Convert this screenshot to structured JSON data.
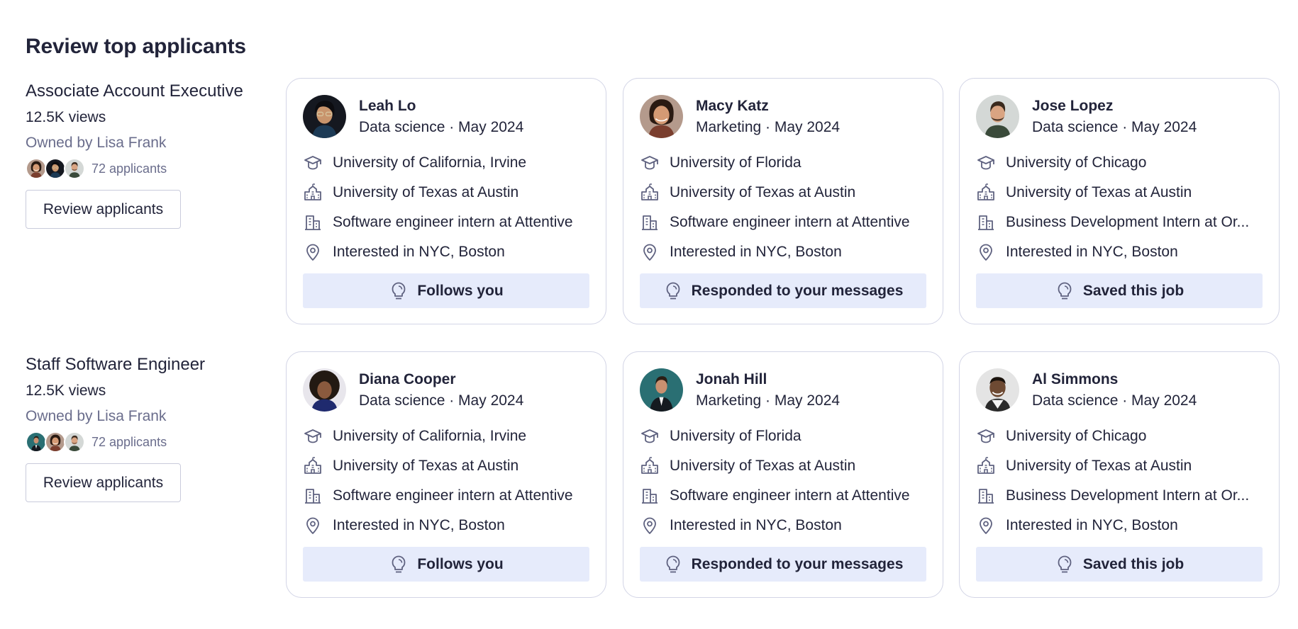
{
  "page": {
    "title": "Review top applicants"
  },
  "colors": {
    "accent_bg": "#e6ebfb",
    "muted_text": "#6a6d8c",
    "card_border": "#d3d5e6"
  },
  "icons": {
    "education": "graduation-cap-icon",
    "school": "school-building-icon",
    "work": "office-building-icon",
    "location": "map-pin-icon",
    "signal": "lightbulb-icon"
  },
  "jobs": [
    {
      "title": "Associate Account Executive",
      "views": "12.5K views",
      "owner": "Owned by Lisa Frank",
      "applicant_count": "72 applicants",
      "review_label": "Review applicants",
      "candidates": [
        {
          "name": "Leah Lo",
          "meta": "Data science · May 2024",
          "education": "University of California, Irvine",
          "school": "University of Texas at Austin",
          "work": "Software engineer intern at Attentive",
          "location": "Interested in NYC, Boston",
          "signal": "Follows you"
        },
        {
          "name": "Macy Katz",
          "meta": "Marketing · May 2024",
          "education": "University of Florida",
          "school": "University of Texas at Austin",
          "work": "Software engineer intern at Attentive",
          "location": "Interested in NYC, Boston",
          "signal": "Responded to your messages"
        },
        {
          "name": "Jose Lopez",
          "meta": "Data science · May 2024",
          "education": "University of Chicago",
          "school": "University of Texas at Austin",
          "work": "Business Development Intern at Or...",
          "location": "Interested in NYC, Boston",
          "signal": "Saved this job"
        }
      ]
    },
    {
      "title": "Staff Software Engineer",
      "views": "12.5K views",
      "owner": "Owned by Lisa Frank",
      "applicant_count": "72 applicants",
      "review_label": "Review applicants",
      "candidates": [
        {
          "name": "Diana Cooper",
          "meta": "Data science · May 2024",
          "education": "University of California, Irvine",
          "school": "University of Texas at Austin",
          "work": "Software engineer intern at Attentive",
          "location": "Interested in NYC, Boston",
          "signal": "Follows you"
        },
        {
          "name": "Jonah Hill",
          "meta": "Marketing · May 2024",
          "education": "University of Florida",
          "school": "University of Texas at Austin",
          "work": "Software engineer intern at Attentive",
          "location": "Interested in NYC, Boston",
          "signal": "Responded to your messages"
        },
        {
          "name": "Al Simmons",
          "meta": "Data science · May 2024",
          "education": "University of Chicago",
          "school": "University of Texas at Austin",
          "work": "Business Development Intern at Or...",
          "location": "Interested in NYC, Boston",
          "signal": "Saved this job"
        }
      ]
    }
  ]
}
